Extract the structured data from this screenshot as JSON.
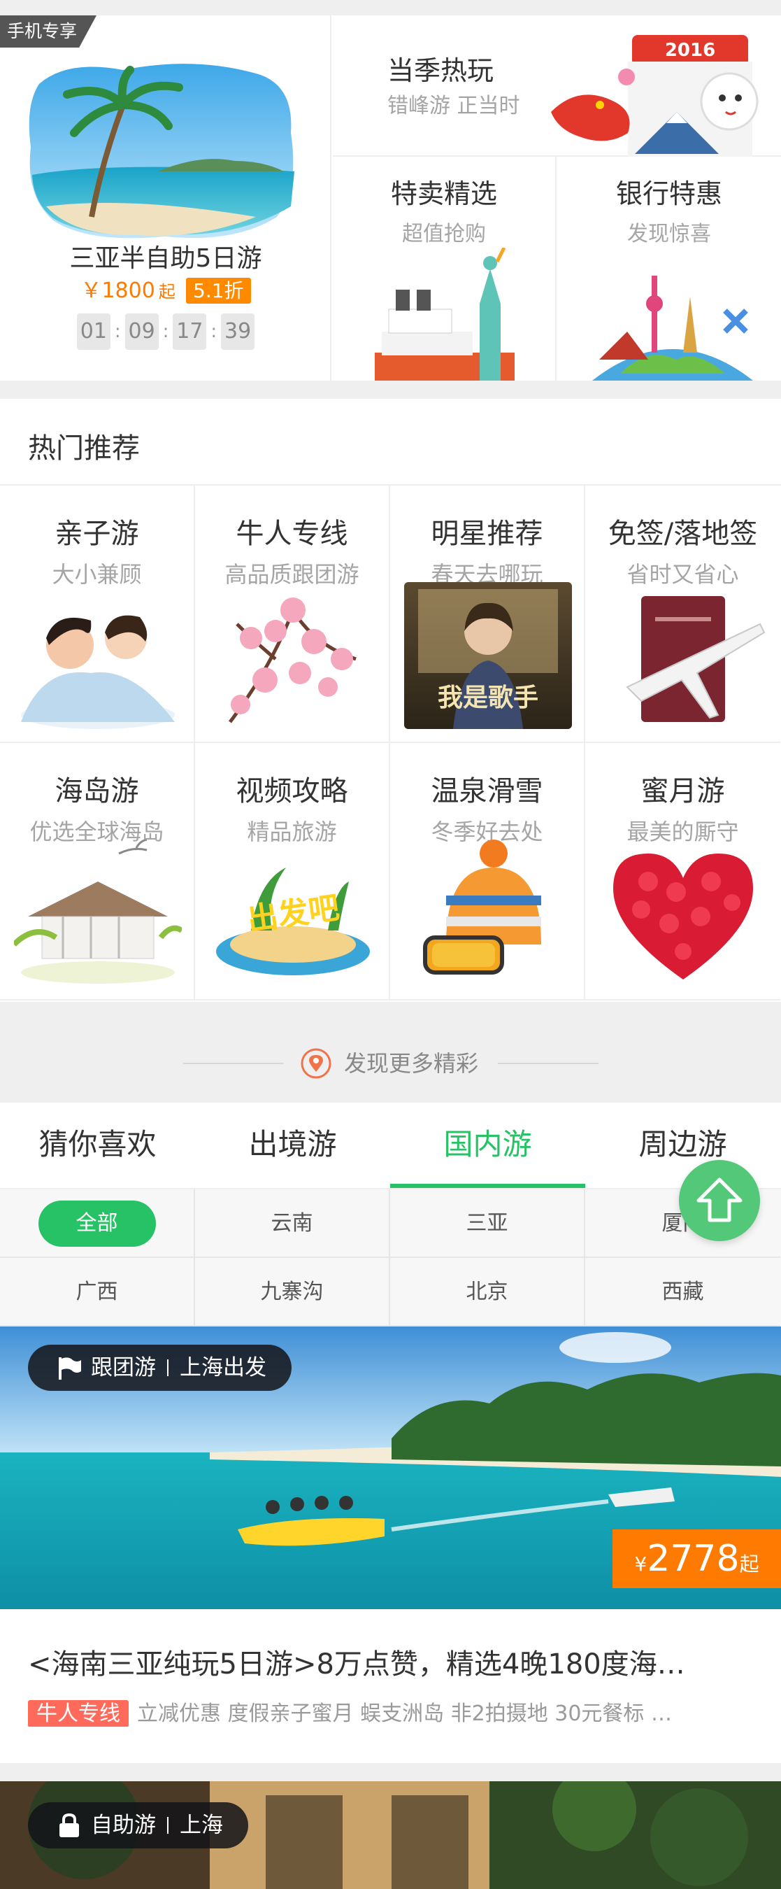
{
  "promo": {
    "ribbon": "手机专享",
    "deal_title": "三亚半自助5日游",
    "price": "￥1800",
    "price_suffix": "起",
    "discount": "5.1折",
    "countdown": [
      "01",
      "09",
      "17",
      "39"
    ],
    "season": {
      "title": "当季热玩",
      "subtitle": "错峰游 正当时",
      "year_badge": "2016"
    },
    "special": {
      "title": "特卖精选",
      "subtitle": "超值抢购"
    },
    "bank": {
      "title": "银行特惠",
      "subtitle": "发现惊喜"
    }
  },
  "hot": {
    "heading": "热门推荐",
    "items": [
      {
        "title": "亲子游",
        "subtitle": "大小兼顾",
        "icon": "family-photo"
      },
      {
        "title": "牛人专线",
        "subtitle": "高品质跟团游",
        "icon": "cherry-blossom"
      },
      {
        "title": "明星推荐",
        "subtitle": "春天去哪玩",
        "icon": "celebrity-poster",
        "poster_text": "我是歌手"
      },
      {
        "title": "免签/落地签",
        "subtitle": "省时又省心",
        "icon": "passport-plane"
      },
      {
        "title": "海岛游",
        "subtitle": "优选全球海岛",
        "icon": "island-hut"
      },
      {
        "title": "视频攻略",
        "subtitle": "精品旅游",
        "icon": "video-island",
        "poster_text": "出发吧"
      },
      {
        "title": "温泉滑雪",
        "subtitle": "冬季好去处",
        "icon": "ski-hat"
      },
      {
        "title": "蜜月游",
        "subtitle": "最美的厮守",
        "icon": "rose-heart"
      }
    ]
  },
  "discover": {
    "label": "发现更多精彩"
  },
  "tabs": [
    {
      "label": "猜你喜欢",
      "active": false
    },
    {
      "label": "出境游",
      "active": false
    },
    {
      "label": "国内游",
      "active": true
    },
    {
      "label": "周边游",
      "active": false
    }
  ],
  "filters": [
    "全部",
    "云南",
    "三亚",
    "厦门",
    "广西",
    "九寨沟",
    "北京",
    "西藏"
  ],
  "products": [
    {
      "tag_type": "跟团游",
      "tag_city": "上海出发",
      "price_symbol": "¥",
      "price": "2778",
      "price_suffix": "起",
      "title": "<海南三亚纯玩5日游>8万点赞，精选4晚180度海…",
      "badge": "牛人专线",
      "desc": "立减优惠 度假亲子蜜月 蜈支洲岛 非2拍摄地 30元餐标 …"
    },
    {
      "tag_type": "自助游",
      "tag_city": "上海"
    }
  ],
  "colors": {
    "accent": "#28c266",
    "orange": "#ff7a00",
    "badge_red": "#ff6a5b"
  }
}
